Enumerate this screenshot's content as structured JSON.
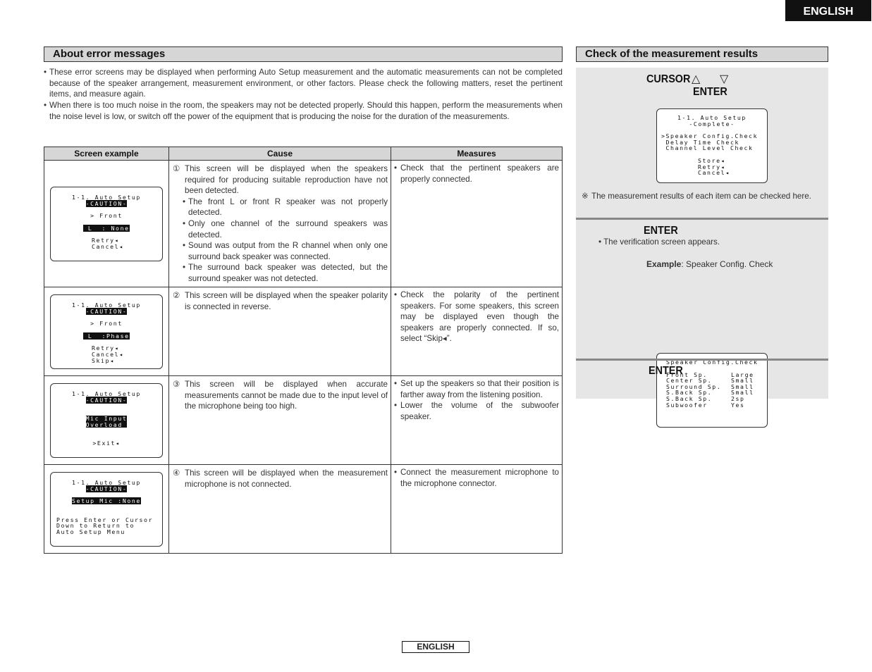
{
  "lang_tab": "ENGLISH",
  "footer_lang": "ENGLISH",
  "left": {
    "title": "About error messages",
    "intro": [
      "These error screens may be displayed when performing Auto Setup measurement and the automatic measurements can not be completed because of the speaker arrangement, measurement environment, or other factors. Please check the following matters, reset the pertinent items, and measure again.",
      "When there is too much noise in the room, the speakers may not be detected properly. Should this happen, perform the measurements when the noise level is low, or switch off the power of the equipment that is producing the noise for the duration of the measurements."
    ],
    "bullet": "•",
    "table": {
      "headers": [
        "Screen example",
        "Cause",
        "Measures"
      ],
      "rows": [
        {
          "screen": {
            "title": "1-1. Auto Setup",
            "caution": "-CAUTION-",
            "line1": "> Front",
            "highlight": " L  : None",
            "options": [
              "Retry◂",
              "Cancel◂"
            ]
          },
          "cause_num": "①",
          "cause_lead": "This screen will be displayed when the speakers required for producing suitable reproduction have not been detected.",
          "cause_subs": [
            "The front L or front R speaker was not properly detected.",
            "Only one channel of the surround speakers was detected.",
            "Sound was output from the R channel when only one surround back speaker was connected.",
            "The surround back speaker was detected, but the surround speaker was not detected."
          ],
          "measures": [
            "Check that the pertinent speakers are properly connected."
          ]
        },
        {
          "screen": {
            "title": "1-1. Auto Setup",
            "caution": "-CAUTION-",
            "line1": "> Front",
            "highlight": " L  :Phase",
            "options": [
              "Retry◂",
              "Cancel◂",
              "Skip◂"
            ]
          },
          "cause_num": "②",
          "cause_lead": "This screen will be displayed when the speaker polarity is connected in reverse.",
          "cause_subs": [],
          "measures": [
            "Check the polarity of the pertinent speakers. For some speakers, this screen may be displayed even though the speakers are properly connected. If so, select “Skip◂”."
          ]
        },
        {
          "screen": {
            "title": "1-1. Auto Setup",
            "caution": "-CAUTION-",
            "highlight_lines": [
              "Mic Input",
              "Overload "
            ],
            "exit": ">Exit◂"
          },
          "cause_num": "③",
          "cause_lead": "This screen will be displayed when accurate measurements cannot be made due to the input level of the microphone being too high.",
          "cause_subs": [],
          "measures": [
            "Set up the speakers so that their position is farther away from the listening position.",
            "Lower the volume of the subwoofer speaker."
          ]
        },
        {
          "screen": {
            "title": "1-1. Auto Setup",
            "caution": "-CAUTION-",
            "highlight": "Setup Mic :None",
            "msg": [
              "Press Enter or Cursor",
              "Down to Return to",
              "Auto Setup Menu"
            ]
          },
          "cause_num": "④",
          "cause_lead": "This screen will be displayed when the measurement microphone is not connected.",
          "cause_subs": [],
          "measures": [
            "Connect the measurement microphone to the microphone connector."
          ]
        }
      ]
    }
  },
  "right": {
    "title": "Check of the measurement results",
    "step1": {
      "cursor_label": "CURSOR",
      "up_icon": "△",
      "down_icon": "▽",
      "enter_label": "ENTER",
      "screen": {
        "title": "1-1. Auto Setup",
        "subtitle": "-Complete-",
        "items": [
          ">Speaker Config.Check",
          " Delay Time Check",
          " Channel Level Check"
        ],
        "options": [
          "Store◂",
          "Retry◂",
          "Cancel◂"
        ]
      },
      "note_mark": "※",
      "note": "The measurement results of each item can be checked here."
    },
    "step2": {
      "enter_label": "ENTER",
      "bullet": "The verification screen appears.",
      "example_label": "Example",
      "example_text": ": Speaker Config. Check",
      "screen": {
        "title": "Speaker Config.Check",
        "rows": [
          {
            "name": "Front Sp.",
            "value": "Large"
          },
          {
            "name": "Center Sp.",
            "value": "Small"
          },
          {
            "name": "Surround Sp.",
            "value": "Small"
          },
          {
            "name": "S.Back Sp.",
            "value": "Small"
          },
          {
            "name": "S.Back Sp.",
            "value": "2sp"
          },
          {
            "name": "Subwoofer",
            "value": "Yes"
          }
        ]
      }
    },
    "step3": {
      "enter_label": "ENTER"
    }
  }
}
